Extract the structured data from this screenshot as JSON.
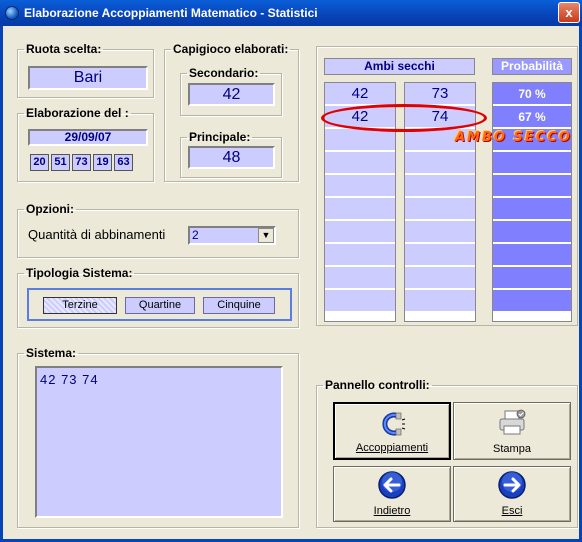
{
  "window": {
    "title": "Elaborazione Accoppiamenti Matematico - Statistici",
    "close_label": "x"
  },
  "ruota": {
    "legend": "Ruota scelta:",
    "value": "Bari"
  },
  "elaborazione": {
    "legend": "Elaborazione del :",
    "date": "29/09/07",
    "numbers": [
      "20",
      "51",
      "73",
      "19",
      "63"
    ]
  },
  "capigioco": {
    "legend": "Capigioco elaborati:",
    "secondario_label": "Secondario:",
    "secondario": "42",
    "principale_label": "Principale:",
    "principale": "48"
  },
  "opzioni": {
    "legend": "Opzioni:",
    "label": "Quantità di abbinamenti",
    "value": "2",
    "arrow": "▼"
  },
  "tipologia": {
    "legend": "Tipologia Sistema:",
    "options": [
      "Terzine",
      "Quartine",
      "Cinquine"
    ],
    "selected": "Terzine"
  },
  "sistema": {
    "legend": "Sistema:",
    "value": "42  73  74"
  },
  "ambi": {
    "header": "Ambi secchi",
    "prob_header": "Probabilità",
    "rows": [
      {
        "a": "42",
        "b": "73",
        "p": "70 %"
      },
      {
        "a": "42",
        "b": "74",
        "p": "67 %"
      }
    ],
    "annotation": "AMBO SECCO"
  },
  "pannello": {
    "legend": "Pannello controlli:",
    "buttons": {
      "accoppiamenti": "Accoppiamenti",
      "stampa": "Stampa",
      "indietro": "Indietro",
      "esci": "Esci"
    }
  },
  "colors": {
    "field_bg": "#ccccff",
    "prob_bg": "#8080ff",
    "titlebar": "#0843b8",
    "highlight": "#e00000",
    "annotation": "#ff6a1a"
  }
}
